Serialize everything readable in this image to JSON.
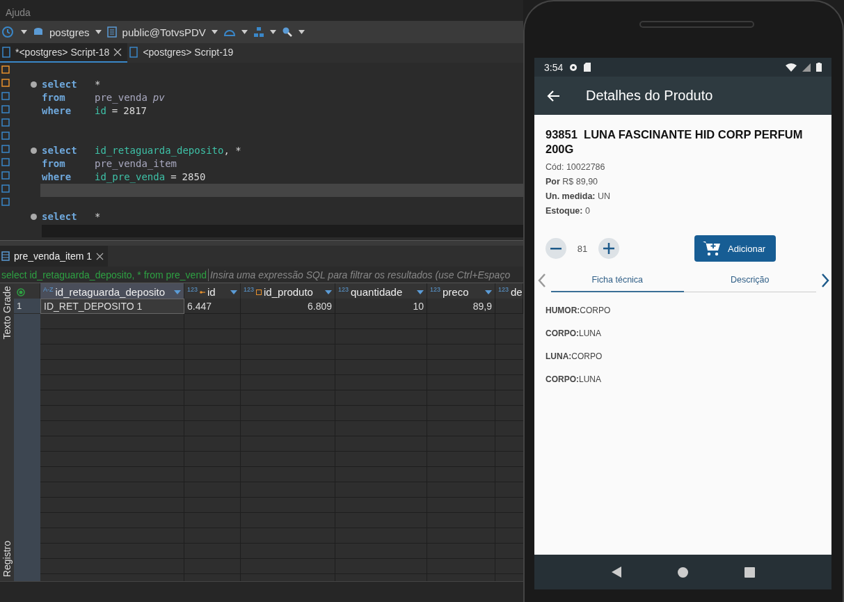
{
  "menu": [
    "Ajuda"
  ],
  "toolbar": {
    "connection": "postgres",
    "schema": "public@TotvsPDV"
  },
  "editor_tabs": [
    {
      "label": "*<postgres> Script-18",
      "selected": true
    },
    {
      "label": "<postgres> Script-19",
      "selected": false
    }
  ],
  "editor": {
    "lines": [
      {
        "fold": true,
        "current": false,
        "tokens": [
          {
            "kind": "keyword",
            "text": "select"
          },
          {
            "kind": "op",
            "text": "*"
          }
        ]
      },
      {
        "fold": false,
        "current": false,
        "tokens": [
          {
            "kind": "keyword",
            "text": "from"
          },
          {
            "kind": "table",
            "text": "pre_venda"
          },
          {
            "kind": "alias",
            "text": "pv"
          }
        ]
      },
      {
        "fold": false,
        "current": false,
        "tokens": [
          {
            "kind": "keyword",
            "text": "where"
          },
          {
            "kind": "ident",
            "text": "id"
          },
          {
            "kind": "op",
            "text": "="
          },
          {
            "kind": "number",
            "text": "2817"
          }
        ]
      },
      {
        "fold": false,
        "current": false
      },
      {
        "fold": false,
        "current": false
      },
      {
        "fold": true,
        "current": false,
        "tokens": [
          {
            "kind": "keyword",
            "text": "select"
          },
          {
            "kind": "ident",
            "text": "id_retaguarda_deposito"
          },
          {
            "kind": "op",
            "text": ", *"
          }
        ]
      },
      {
        "fold": false,
        "current": false,
        "tokens": [
          {
            "kind": "keyword",
            "text": "from"
          },
          {
            "kind": "table",
            "text": "pre_venda_item"
          }
        ]
      },
      {
        "fold": false,
        "current": false,
        "tokens": [
          {
            "kind": "keyword",
            "text": "where"
          },
          {
            "kind": "ident",
            "text": "id_pre_venda"
          },
          {
            "kind": "op",
            "text": "="
          },
          {
            "kind": "number",
            "text": "2850"
          }
        ]
      },
      {
        "fold": false,
        "current": true
      },
      {
        "fold": false,
        "current": false
      },
      {
        "fold": true,
        "current": false,
        "tokens": [
          {
            "kind": "keyword",
            "text": "select"
          },
          {
            "kind": "op",
            "text": "*"
          }
        ]
      }
    ]
  },
  "results": {
    "tab": "pre_venda_item 1",
    "query": "select id_retaguarda_deposito, * from pre_vend",
    "filter_placeholder": "Insira uma expressão SQL para filtrar os resultados (use Ctrl+Espaço",
    "columns": [
      {
        "type": "A-Z",
        "name": "id_retaguarda_deposito"
      },
      {
        "type": "123",
        "name": "id"
      },
      {
        "type": "123",
        "name": "id_produto"
      },
      {
        "type": "123",
        "name": "quantidade"
      },
      {
        "type": "123",
        "name": "preco"
      },
      {
        "type": "123",
        "name": "de"
      }
    ],
    "rows": [
      {
        "number": "1",
        "cells": [
          "ID_RET_DEPOSITO 1",
          "6.447",
          "6.809",
          "10",
          "89,9"
        ]
      }
    ]
  },
  "side_tabs": [
    "Grade",
    "Texto",
    "Registro"
  ],
  "phone": {
    "time": "3:54",
    "app_title": "Detalhes do Produto",
    "product_title": "93851  LUNA FASCINANTE HID CORP PERFUM 200G",
    "code": "Cód: 10022786",
    "details": [
      "**Por**  R$ 89,90",
      "**Un. medida:** UN",
      "**Estoque:** 0"
    ],
    "quantity": "81",
    "add_button": "Adicionar",
    "tabs": [
      {
        "label": "Ficha técnica",
        "selected": true
      },
      {
        "label": "Descrição",
        "selected": false
      }
    ],
    "specs": [
      "**HUMOR:**CORPO",
      "**CORPO:**LUNA",
      "**LUNA:**CORPO",
      "**CORPO:**LUNA"
    ]
  }
}
